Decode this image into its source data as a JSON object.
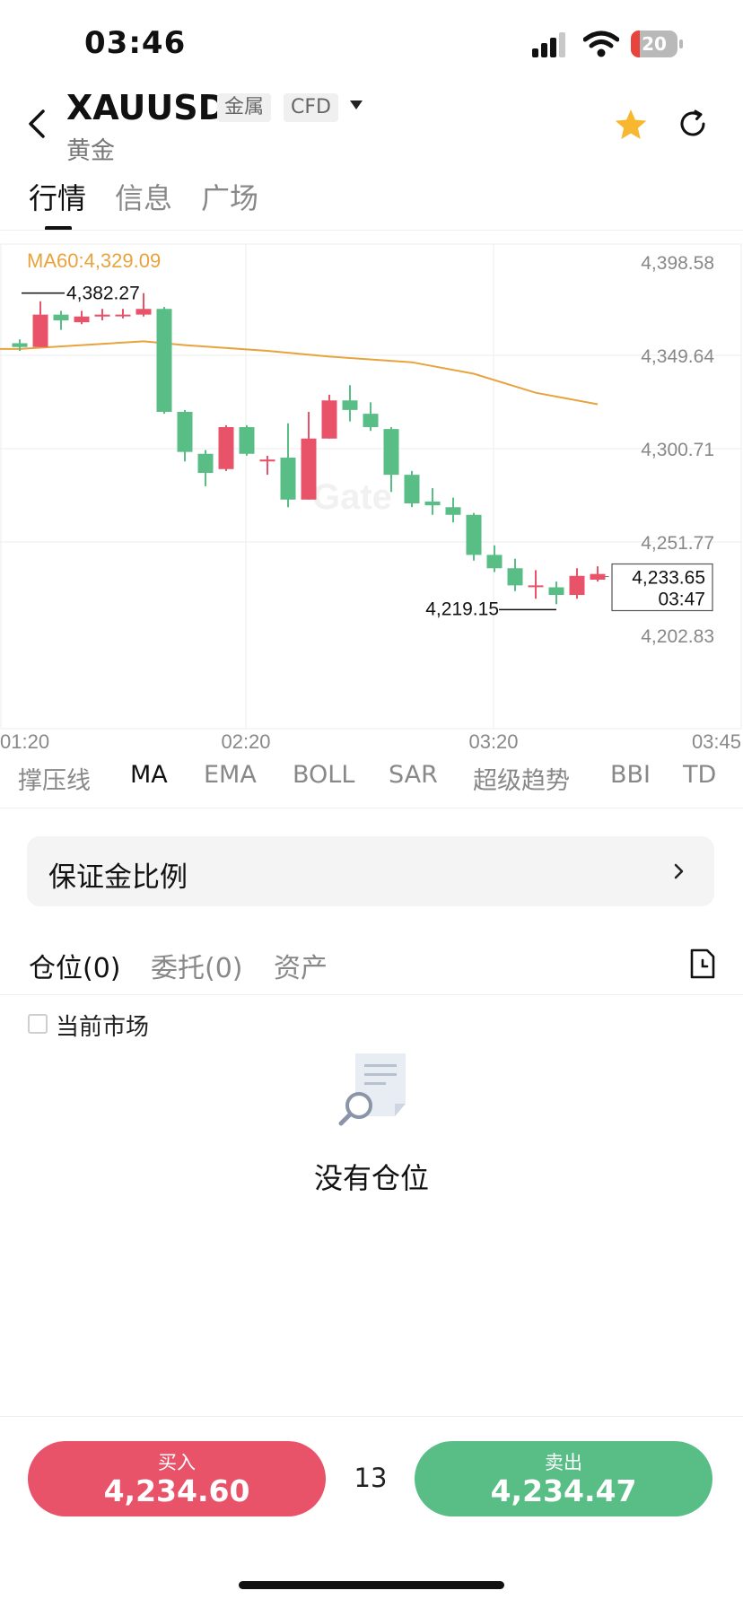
{
  "status_bar": {
    "time": "03:46",
    "battery": "20",
    "battery_level_percent": 20
  },
  "header": {
    "symbol": "XAUUSD",
    "tags": [
      "金属",
      "CFD"
    ],
    "name": "黄金",
    "icons": [
      "back-arrow-icon",
      "star-icon",
      "refresh-icon",
      "caret-down-icon"
    ],
    "star_color": "#f7b731"
  },
  "tabs": [
    {
      "label": "行情",
      "active": true
    },
    {
      "label": "信息",
      "active": false
    },
    {
      "label": "广场",
      "active": false
    }
  ],
  "chart_data": {
    "type": "candlestick",
    "indicator_label": "MA60:4,329.09",
    "ma_color": "#e8a33d",
    "up_color": "#e9536a",
    "down_color": "#59be86",
    "y_ticks": [
      "4,398.58",
      "4,349.64",
      "4,300.71",
      "4,251.77",
      "4,202.83"
    ],
    "y_tick_values": [
      4398.58,
      4349.64,
      4300.71,
      4251.77,
      4202.83
    ],
    "x_ticks": [
      "01:20",
      "02:20",
      "03:20",
      "03:45"
    ],
    "high_label": "4,382.27",
    "high_value": 4382.27,
    "low_label": "4,219.15",
    "low_value": 4219.15,
    "last_price": "4,233.65",
    "last_price_value": 4233.65,
    "last_time": "03:47",
    "candles": [
      {
        "open": 4356.0,
        "high": 4358.0,
        "low": 4352.0,
        "close": 4354.0
      },
      {
        "open": 4354.0,
        "high": 4378.0,
        "low": 4354.0,
        "close": 4371.0
      },
      {
        "open": 4371.0,
        "high": 4373.0,
        "low": 4363.0,
        "close": 4368.0
      },
      {
        "open": 4367.0,
        "high": 4373.0,
        "low": 4366.0,
        "close": 4370.0
      },
      {
        "open": 4370.0,
        "high": 4374.0,
        "low": 4368.0,
        "close": 4371.0
      },
      {
        "open": 4371.0,
        "high": 4374.0,
        "low": 4369.0,
        "close": 4371.0
      },
      {
        "open": 4371.0,
        "high": 4382.27,
        "low": 4370.0,
        "close": 4374.0
      },
      {
        "open": 4374.0,
        "high": 4375.0,
        "low": 4319.0,
        "close": 4320.0
      },
      {
        "open": 4320.0,
        "high": 4321.0,
        "low": 4294.0,
        "close": 4299.0
      },
      {
        "open": 4298.0,
        "high": 4300.0,
        "low": 4281.0,
        "close": 4288.0
      },
      {
        "open": 4290.0,
        "high": 4313.0,
        "low": 4289.0,
        "close": 4312.0
      },
      {
        "open": 4312.0,
        "high": 4313.0,
        "low": 4297.0,
        "close": 4298.0
      },
      {
        "open": 4294.0,
        "high": 4297.0,
        "low": 4287.0,
        "close": 4295.0
      },
      {
        "open": 4296.0,
        "high": 4314.0,
        "low": 4270.0,
        "close": 4274.0
      },
      {
        "open": 4274.0,
        "high": 4320.0,
        "low": 4274.0,
        "close": 4306.0
      },
      {
        "open": 4306.0,
        "high": 4329.0,
        "low": 4306.0,
        "close": 4326.0
      },
      {
        "open": 4326.0,
        "high": 4334.0,
        "low": 4315.0,
        "close": 4321.0
      },
      {
        "open": 4319.0,
        "high": 4325.0,
        "low": 4310.0,
        "close": 4312.0
      },
      {
        "open": 4311.0,
        "high": 4312.0,
        "low": 4278.0,
        "close": 4287.0
      },
      {
        "open": 4287.0,
        "high": 4289.0,
        "low": 4270.0,
        "close": 4272.0
      },
      {
        "open": 4273.0,
        "high": 4280.0,
        "low": 4266.0,
        "close": 4271.0
      },
      {
        "open": 4270.0,
        "high": 4275.0,
        "low": 4262.0,
        "close": 4266.0
      },
      {
        "open": 4266.0,
        "high": 4267.0,
        "low": 4242.0,
        "close": 4245.0
      },
      {
        "open": 4245.0,
        "high": 4250.0,
        "low": 4236.0,
        "close": 4238.0
      },
      {
        "open": 4238.0,
        "high": 4243.0,
        "low": 4226.0,
        "close": 4229.0
      },
      {
        "open": 4229.0,
        "high": 4237.0,
        "low": 4222.0,
        "close": 4229.0
      },
      {
        "open": 4228.0,
        "high": 4231.0,
        "low": 4219.15,
        "close": 4224.0
      },
      {
        "open": 4224.0,
        "high": 4238.0,
        "low": 4222.0,
        "close": 4234.0
      },
      {
        "open": 4232.0,
        "high": 4239.0,
        "low": 4231.0,
        "close": 4235.0
      }
    ],
    "ma60": [
      {
        "i": 0,
        "v": 4353.0
      },
      {
        "i": 6,
        "v": 4357.0
      },
      {
        "i": 8,
        "v": 4355.0
      },
      {
        "i": 12,
        "v": 4352.0
      },
      {
        "i": 15,
        "v": 4349.0
      },
      {
        "i": 19,
        "v": 4346.0
      },
      {
        "i": 22,
        "v": 4340.0
      },
      {
        "i": 25,
        "v": 4330.0
      },
      {
        "i": 28,
        "v": 4324.0
      }
    ],
    "y_range": [
      4202.83,
      4398.58
    ]
  },
  "indicators": [
    {
      "label": "撑压线",
      "active": false
    },
    {
      "label": "MA",
      "active": true
    },
    {
      "label": "EMA",
      "active": false
    },
    {
      "label": "BOLL",
      "active": false
    },
    {
      "label": "SAR",
      "active": false
    },
    {
      "label": "超级趋势",
      "active": false
    },
    {
      "label": "BBI",
      "active": false
    },
    {
      "label": "TD",
      "active": false
    }
  ],
  "margin_ratio": {
    "label": "保证金比例"
  },
  "position_tabs": [
    {
      "label": "仓位(0)",
      "active": true
    },
    {
      "label": "委托(0)",
      "active": false
    },
    {
      "label": "资产",
      "active": false
    }
  ],
  "current_market": {
    "label": "当前市场",
    "checked": false
  },
  "empty_state": {
    "text": "没有仓位"
  },
  "trade": {
    "buy_label": "买入",
    "buy_price": "4,234.60",
    "sell_label": "卖出",
    "sell_price": "4,234.47",
    "spread": "13"
  }
}
